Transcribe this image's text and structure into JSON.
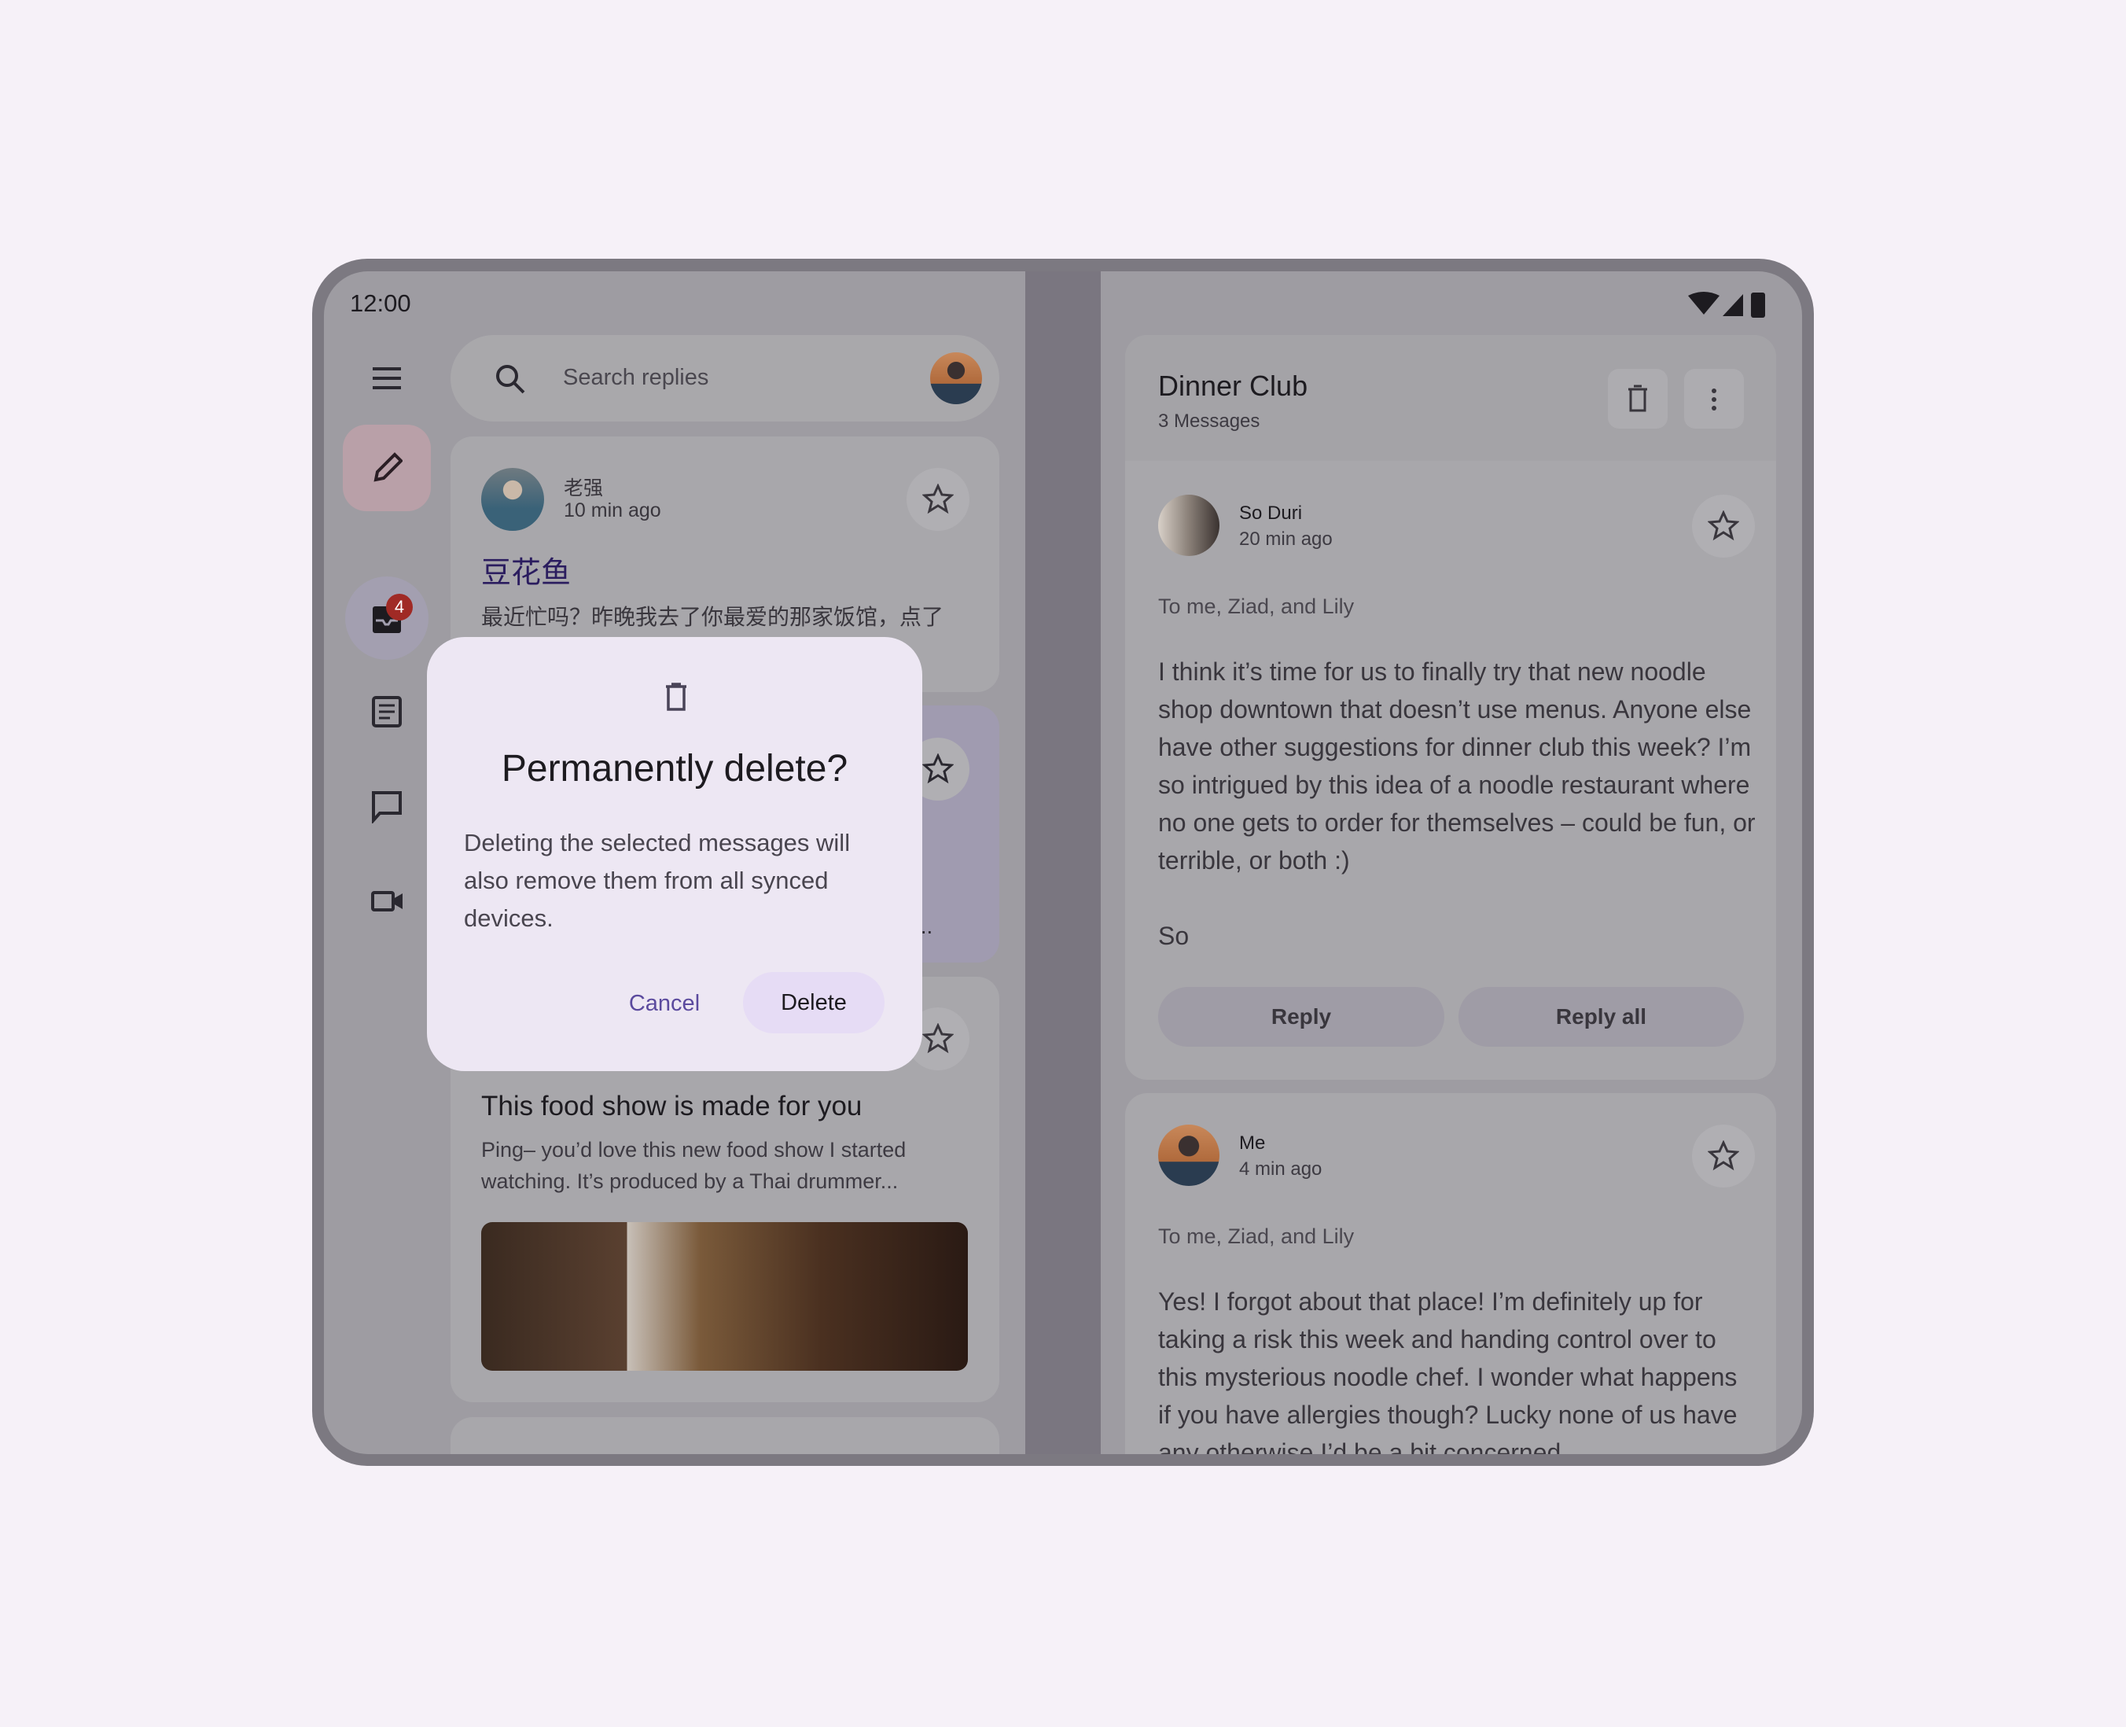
{
  "status_bar": {
    "time": "12:00",
    "icons": [
      "wifi-icon",
      "signal-icon",
      "battery-icon"
    ]
  },
  "rail": {
    "items": [
      {
        "icon": "menu-icon"
      },
      {
        "icon": "compose-icon"
      },
      {
        "icon": "inbox-icon",
        "badge": "4"
      },
      {
        "icon": "articles-icon"
      },
      {
        "icon": "chat-icon"
      },
      {
        "icon": "video-icon"
      }
    ]
  },
  "search": {
    "placeholder": "Search replies"
  },
  "list": [
    {
      "sender": "老强",
      "time": "10 min ago",
      "subject": "豆花鱼",
      "preview": "最近忙吗？昨晚我去了你最爱的那家饭馆，点了"
    },
    {
      "preview_tail": "..."
    },
    {
      "subject": "This food show is made for you",
      "preview": "Ping– you’d love this new food show I started watching. It’s produced by a Thai drummer..."
    }
  ],
  "dialog": {
    "title": "Permanently delete?",
    "body": "Deleting the selected messages will also remove them from all synced devices.",
    "cancel": "Cancel",
    "confirm": "Delete"
  },
  "thread": {
    "title": "Dinner Club",
    "count": "3 Messages",
    "messages": [
      {
        "sender": "So Duri",
        "time": "20 min ago",
        "recipients": "To me, Ziad, and Lily",
        "body": "I think it’s time for us to finally try that new noodle shop downtown that doesn’t use menus. Anyone else have other suggestions for dinner club this week? I’m so intrigued by this idea of a noodle restaurant where no one gets to order for themselves – could be fun, or terrible, or both :)",
        "signoff": "So",
        "reply": "Reply",
        "reply_all": "Reply all"
      },
      {
        "sender": "Me",
        "time": "4 min ago",
        "recipients": "To me, Ziad, and Lily",
        "body": "Yes! I forgot about that place! I’m definitely up for taking a risk this week and handing control over to this mysterious noodle chef. I wonder what happens if you have allergies though? Lucky none of us have any otherwise I’d be a bit concerned."
      }
    ]
  },
  "colors": {
    "scrim_bg": "#9e9ca2",
    "dialog_bg": "#ede7f3",
    "accent": "#5b4a9e",
    "selected_card": "#a09bb0",
    "badge": "#b3261e"
  }
}
